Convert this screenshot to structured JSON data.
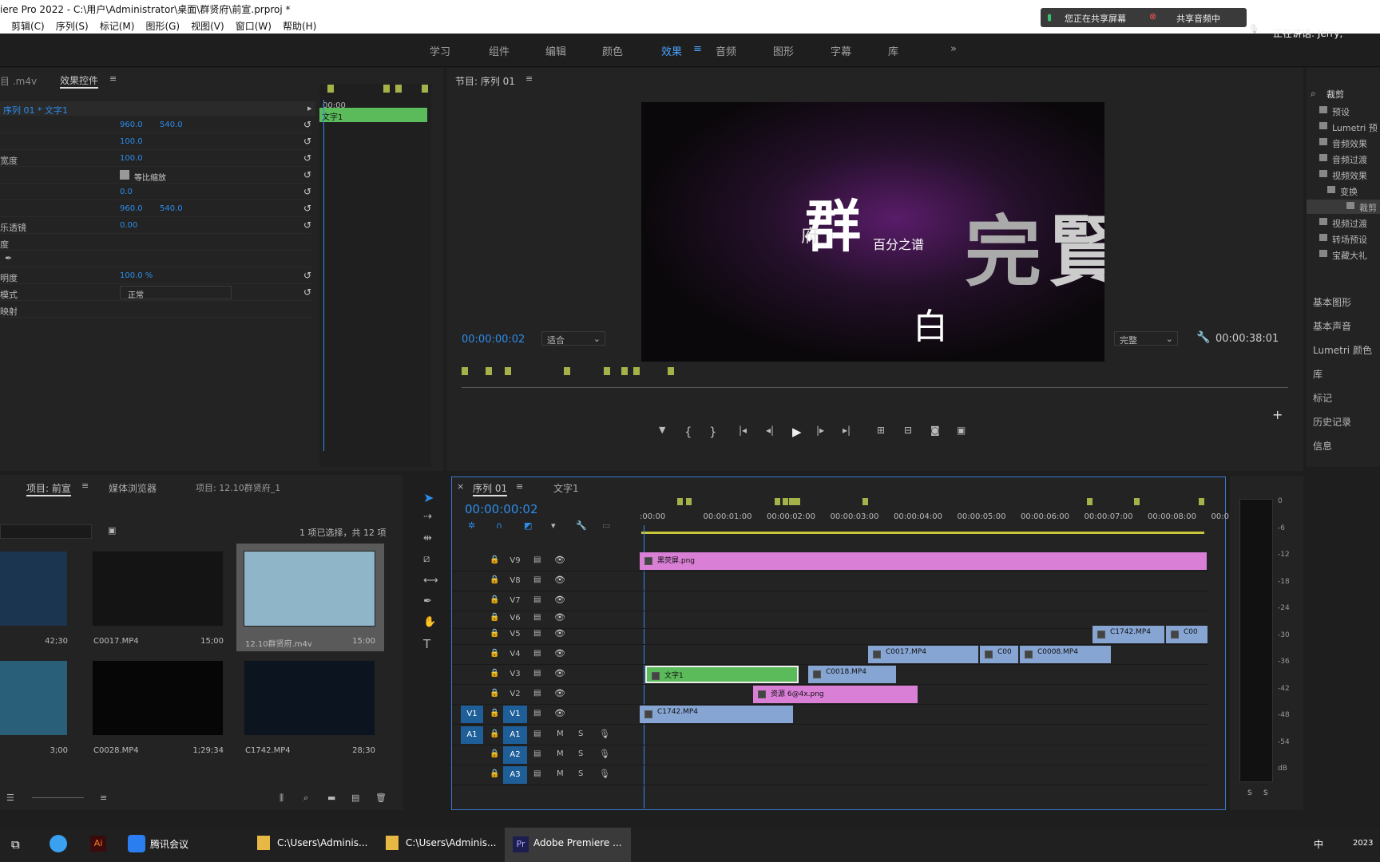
{
  "window": {
    "title": "iere Pro 2022 - C:\\用户\\Administrator\\桌面\\群贤府\\前宣.prproj *"
  },
  "menu": [
    "剪辑(C)",
    "序列(S)",
    "标记(M)",
    "图形(G)",
    "视图(V)",
    "窗口(W)",
    "帮助(H)"
  ],
  "share": {
    "sharing": "您正在共享屏幕",
    "audio": "共享音频中",
    "speaking": "正在讲话: Jerry;"
  },
  "workspaces": [
    "学习",
    "组件",
    "编辑",
    "颜色",
    "效果",
    "音频",
    "图形",
    "字幕",
    "库"
  ],
  "effect_controls": {
    "tab_left": "目 .m4v",
    "tab": "效果控件",
    "clip_path": "序列 01 * 文字1",
    "ruler_start": "00:00",
    "clip_label": "文字1",
    "rows": [
      {
        "label": "",
        "v1": "960.0",
        "v2": "540.0"
      },
      {
        "label": "",
        "v1": "100.0",
        "v2": ""
      },
      {
        "label": "宽度",
        "v1": "100.0",
        "v2": ""
      },
      {
        "label": "",
        "v1": "等比缩放",
        "v2": ""
      },
      {
        "label": "",
        "v1": "0.0",
        "v2": ""
      },
      {
        "label": "",
        "v1": "960.0",
        "v2": "540.0"
      },
      {
        "label": "乐透镜",
        "v1": "0.00",
        "v2": ""
      },
      {
        "label": "度",
        "v1": "",
        "v2": ""
      },
      {
        "label": "",
        "v1": "",
        "v2": ""
      },
      {
        "label": "明度",
        "v1": "100.0 %",
        "v2": ""
      },
      {
        "label": "模式",
        "v1": "正常",
        "v2": ""
      },
      {
        "label": "映射",
        "v1": "",
        "v2": ""
      }
    ]
  },
  "program": {
    "title": "节目: 序列 01",
    "timecode": "00:00:00:02",
    "fit": "适合",
    "quality": "完整",
    "duration": "00:00:38:01",
    "frame_text": {
      "big1": "群",
      "small1": "府",
      "sub": "百分之谱",
      "big2": "完",
      "big3": "賢",
      "small2": "白"
    }
  },
  "project": {
    "tab": "项目: 前宣",
    "tab2": "媒体浏览器",
    "tab3": "项目: 12.10群贤府_1",
    "status": "1 项已选择，共 12 项",
    "items": [
      {
        "name": "",
        "dur": "42;30"
      },
      {
        "name": "C0017.MP4",
        "dur": "15;00"
      },
      {
        "name": "12.10群贤府.m4v",
        "dur": "15:00"
      },
      {
        "name": "",
        "dur": "3;00"
      },
      {
        "name": "C0028.MP4",
        "dur": "1;29;34"
      },
      {
        "name": "C1742.MP4",
        "dur": "28;30"
      }
    ]
  },
  "timeline": {
    "tab": "序列 01",
    "tab2": "文字1",
    "timecode": "00:00:00:02",
    "ruler": [
      ":00:00",
      "00:00:01:00",
      "00:00:02:00",
      "00:00:03:00",
      "00:00:04:00",
      "00:00:05:00",
      "00:00:06:00",
      "00:00:07:00",
      "00:00:08:00",
      "00:0"
    ],
    "tracks": [
      "V9",
      "V8",
      "V7",
      "V6",
      "V5",
      "V4",
      "V3",
      "V2",
      "V1",
      "A1",
      "A2",
      "A3"
    ],
    "clips": [
      {
        "track": "V9",
        "label": "黑荧屏.png",
        "kind": "pink"
      },
      {
        "track": "V5",
        "label": "C1742.MP4",
        "kind": "blue"
      },
      {
        "track": "V5",
        "label": "C00",
        "kind": "blue"
      },
      {
        "track": "V4",
        "label": "C0017.MP4",
        "kind": "blue"
      },
      {
        "track": "V4",
        "label": "C00",
        "kind": "blue"
      },
      {
        "track": "V4",
        "label": "C0008.MP4",
        "kind": "blue"
      },
      {
        "track": "V3",
        "label": "文字1",
        "kind": "green"
      },
      {
        "track": "V3",
        "label": "C0018.MP4",
        "kind": "blue"
      },
      {
        "track": "V2",
        "label": "资源 6@4x.png",
        "kind": "pink"
      },
      {
        "track": "V1",
        "label": "C1742.MP4",
        "kind": "blue"
      }
    ],
    "meter": [
      "0",
      "-6",
      "-12",
      "-18",
      "-24",
      "-30",
      "-36",
      "-42",
      "-48",
      "-54",
      "dB"
    ]
  },
  "effects": {
    "search": "裁剪",
    "tree": [
      "预设",
      "Lumetri 预",
      "音频效果",
      "音频过渡",
      "视频效果",
      "变换",
      "裁剪",
      "视频过渡",
      "转场预设",
      "宝藏大礼"
    ],
    "sections": [
      "基本图形",
      "基本声音",
      "Lumetri 颜色",
      "库",
      "标记",
      "历史记录",
      "信息"
    ]
  },
  "taskbar": {
    "items": [
      "腾讯会议",
      "C:\\Users\\Adminis...",
      "C:\\Users\\Adminis...",
      "Adobe Premiere ..."
    ],
    "ime": "中",
    "year": "2023"
  }
}
